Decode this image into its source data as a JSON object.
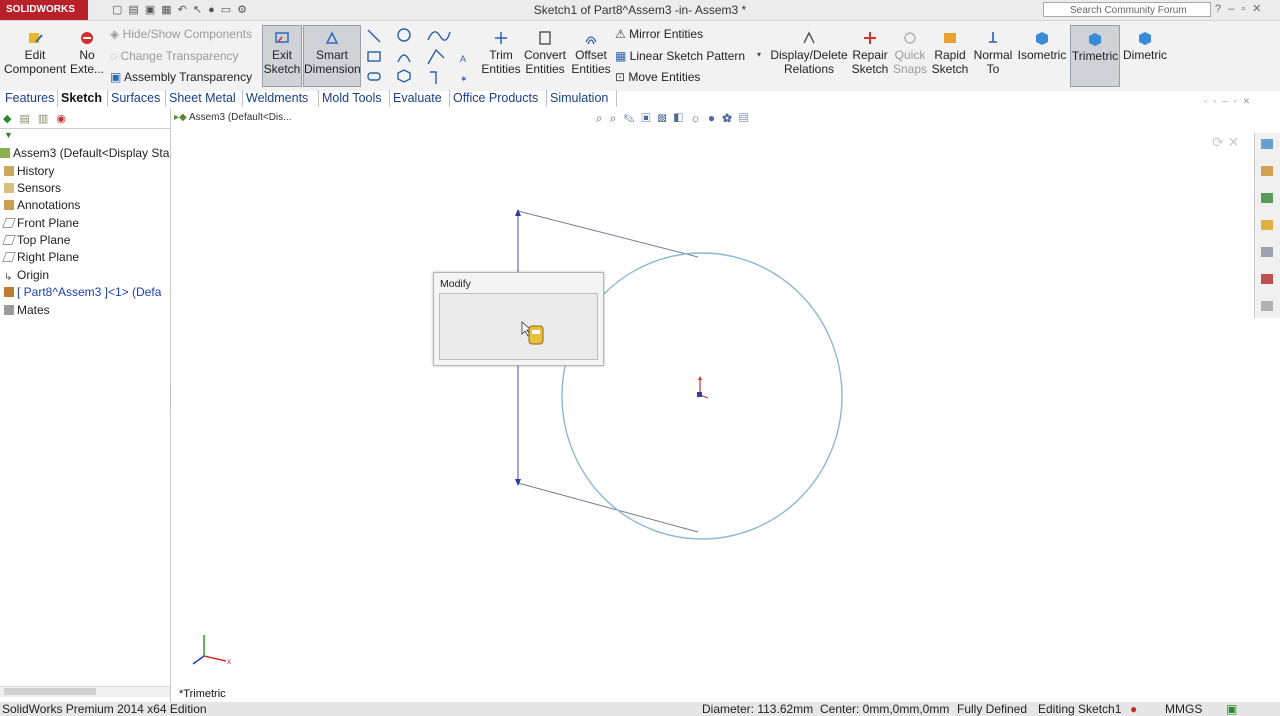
{
  "app": {
    "logo": "SOLIDWORKS",
    "window_title": "Sketch1 of Part8^Assem3 -in- Assem3 *",
    "search_placeholder": "Search Community Forum"
  },
  "toolbar": {
    "edit_component": [
      "Edit",
      "Component"
    ],
    "no_external": [
      "No",
      "Exte..."
    ],
    "hide_show": "Hide/Show Components",
    "change_transparency": "Change Transparency",
    "assembly_transparency": "Assembly Transparency",
    "exit_sketch": [
      "Exit",
      "Sketch"
    ],
    "smart_dimension": [
      "Smart",
      "Dimension"
    ],
    "trim_entities": [
      "Trim",
      "Entities"
    ],
    "convert_entities": [
      "Convert",
      "Entities"
    ],
    "offset_entities": [
      "Offset",
      "Entities"
    ],
    "mirror_entities": "Mirror Entities",
    "linear_pattern": "Linear Sketch Pattern",
    "move_entities": "Move Entities",
    "display_delete": [
      "Display/Delete",
      "Relations"
    ],
    "repair_sketch": [
      "Repair",
      "Sketch"
    ],
    "quick_snaps": [
      "Quick",
      "Snaps"
    ],
    "rapid_sketch": [
      "Rapid",
      "Sketch"
    ],
    "normal_to": [
      "Normal",
      "To"
    ],
    "isometric": "Isometric",
    "trimetric": "Trimetric",
    "dimetric": "Dimetric"
  },
  "tabs": [
    "Features",
    "Sketch",
    "Surfaces",
    "Sheet Metal",
    "Weldments",
    "Mold Tools",
    "Evaluate",
    "Office Products",
    "Simulation"
  ],
  "active_tab": "Sketch",
  "tree": {
    "root": "Assem3  (Default<Display Sta",
    "items": [
      "History",
      "Sensors",
      "Annotations",
      "Front Plane",
      "Top Plane",
      "Right Plane",
      "Origin",
      "[ Part8^Assem3 ]<1> (Defa",
      "Mates"
    ]
  },
  "breadcrumb": "Assem3  (Default<Dis...",
  "view_label": "*Trimetric",
  "modify_dialog": {
    "title": "Modify"
  },
  "status": {
    "edition": "SolidWorks Premium 2014 x64 Edition",
    "diameter": "Diameter: 113.62mm",
    "center": "Center: 0mm,0mm,0mm",
    "defined": "Fully Defined",
    "editing": "Editing Sketch1",
    "units": "MMGS"
  },
  "colors": {
    "logo_red": "#b8202a",
    "sketch_blue": "#8fb8d4",
    "line_gray": "#7a7a90"
  }
}
